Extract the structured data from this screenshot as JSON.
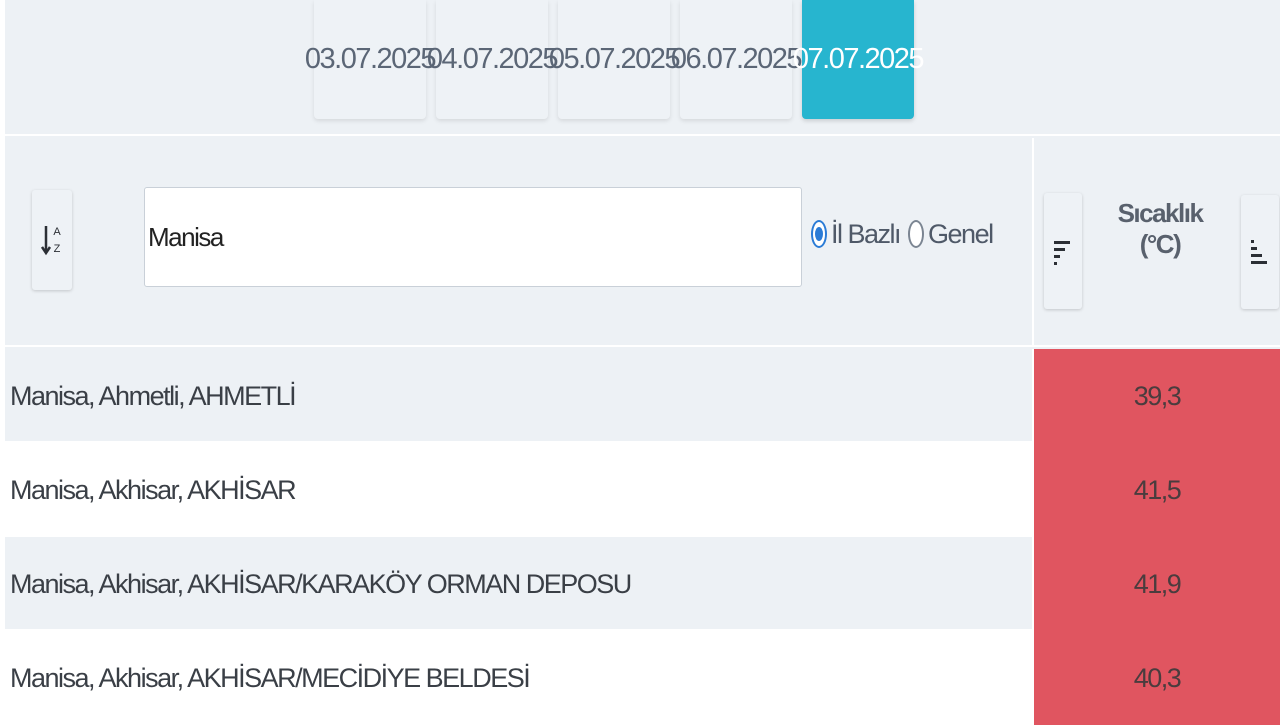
{
  "date_tabs": [
    {
      "label": "03.07.2025",
      "active": false
    },
    {
      "label": "04.07.2025",
      "active": false
    },
    {
      "label": "05.07.2025",
      "active": false
    },
    {
      "label": "06.07.2025",
      "active": false
    },
    {
      "label": "07.07.2025",
      "active": true
    }
  ],
  "filter": {
    "search_value": "Manisa",
    "radio_options": [
      {
        "label": "İl Bazlı",
        "checked": true
      },
      {
        "label": "Genel",
        "checked": false
      }
    ]
  },
  "table": {
    "temperature_header": "Sıcaklık (°C)",
    "rows": [
      {
        "location": "Manisa, Ahmetli, AHMETLİ",
        "temperature": "39,3"
      },
      {
        "location": "Manisa, Akhisar, AKHİSAR",
        "temperature": "41,5"
      },
      {
        "location": "Manisa, Akhisar, AKHİSAR/KARAKÖY ORMAN DEPOSU",
        "temperature": "41,9"
      },
      {
        "location": "Manisa, Akhisar, AKHİSAR/MECİDİYE BELDESİ",
        "temperature": "40,3"
      }
    ]
  },
  "colors": {
    "active_tab": "#27b5cf",
    "hot_cell": "#e05560",
    "radio_checked": "#2a7bd6"
  },
  "icons": {
    "sort_alpha": "sort-alpha-icon",
    "sort_descending": "sort-descending-icon",
    "sort_ascending": "sort-ascending-icon"
  }
}
